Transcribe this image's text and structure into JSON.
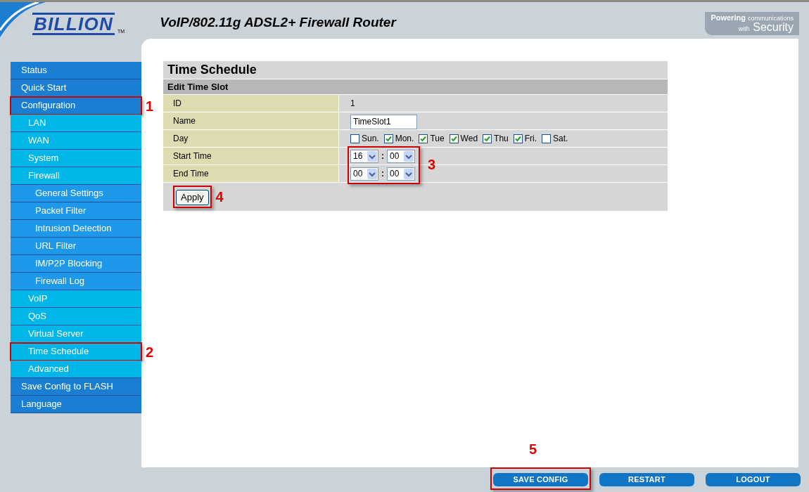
{
  "header": {
    "logo": "BILLION",
    "trademark": "TM",
    "title": "VoIP/802.11g ADSL2+ Firewall Router",
    "tagline_strong": "Powering",
    "tagline_small": "communications",
    "tagline_with": "with",
    "tagline_big": "Security"
  },
  "sidebar": {
    "items": [
      {
        "label": "Status"
      },
      {
        "label": "Quick Start"
      },
      {
        "label": "Configuration",
        "callout": "1",
        "children": [
          {
            "label": "LAN"
          },
          {
            "label": "WAN"
          },
          {
            "label": "System"
          },
          {
            "label": "Firewall",
            "children": [
              {
                "label": "General Settings"
              },
              {
                "label": "Packet Filter"
              },
              {
                "label": "Intrusion Detection"
              },
              {
                "label": "URL Filter"
              },
              {
                "label": "IM/P2P Blocking"
              },
              {
                "label": "Firewall Log"
              }
            ]
          },
          {
            "label": "VoIP"
          },
          {
            "label": "QoS"
          },
          {
            "label": "Virtual Server"
          },
          {
            "label": "Time Schedule",
            "callout": "2"
          },
          {
            "label": "Advanced"
          }
        ]
      },
      {
        "label": "Save Config to FLASH"
      },
      {
        "label": "Language"
      }
    ]
  },
  "form": {
    "title": "Time Schedule",
    "section": "Edit Time Slot",
    "rows": [
      {
        "kind": "text",
        "label": "ID",
        "value": "1"
      },
      {
        "kind": "input",
        "label": "Name",
        "value": "TimeSlot1"
      },
      {
        "kind": "days",
        "label": "Day",
        "days": [
          {
            "label": "Sun.",
            "checked": false
          },
          {
            "label": "Mon.",
            "checked": true
          },
          {
            "label": "Tue",
            "checked": true
          },
          {
            "label": "Wed",
            "checked": true
          },
          {
            "label": "Thu",
            "checked": true
          },
          {
            "label": "Fri.",
            "checked": true
          },
          {
            "label": "Sat.",
            "checked": false
          }
        ]
      },
      {
        "kind": "time",
        "label": "Start Time",
        "hour": "16",
        "separator": ":",
        "minute": "00"
      },
      {
        "kind": "time",
        "label": "End Time",
        "hour": "00",
        "separator": ":",
        "minute": "00"
      }
    ],
    "time_callout": "3",
    "apply": {
      "label": "Apply",
      "callout": "4"
    }
  },
  "footer": {
    "buttons": [
      {
        "label": "SAVE CONFIG",
        "callout": "5"
      },
      {
        "label": "RESTART"
      },
      {
        "label": "LOGOUT"
      }
    ]
  }
}
